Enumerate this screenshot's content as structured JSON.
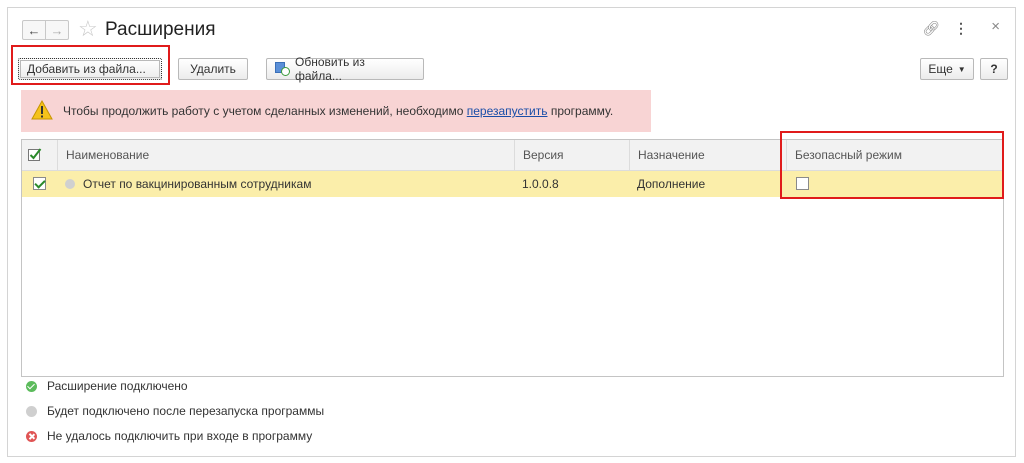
{
  "window": {
    "title": "Расширения",
    "nav_back": "←",
    "nav_forward": "→"
  },
  "toolbar": {
    "add_from_file": "Добавить из файла...",
    "delete": "Удалить",
    "update_from_file": "Обновить из файла...",
    "more": "Еще",
    "help": "?"
  },
  "warning": {
    "text_before": "Чтобы продолжить работу с учетом сделанных изменений, необходимо ",
    "link": "перезапустить",
    "text_after": " программу."
  },
  "table": {
    "columns": {
      "name": "Наименование",
      "version": "Версия",
      "purpose": "Назначение",
      "safe_mode": "Безопасный режим"
    },
    "rows": [
      {
        "active": true,
        "name": "Отчет по вакцинированным сотрудникам",
        "version": "1.0.0.8",
        "purpose": "Дополнение",
        "safe_mode": false
      }
    ]
  },
  "legend": [
    {
      "icon": "green-check-dot",
      "label": "Расширение подключено"
    },
    {
      "icon": "gray-dot",
      "label": "Будет подключено после перезапуска программы"
    },
    {
      "icon": "red-cross-dot",
      "label": "Не удалось подключить при входе в программу"
    }
  ],
  "colors": {
    "highlight_red": "#e01b1b",
    "warning_bg": "#f8d4d4",
    "selected_row": "#fbeeaa",
    "link": "#1a4ea8"
  }
}
